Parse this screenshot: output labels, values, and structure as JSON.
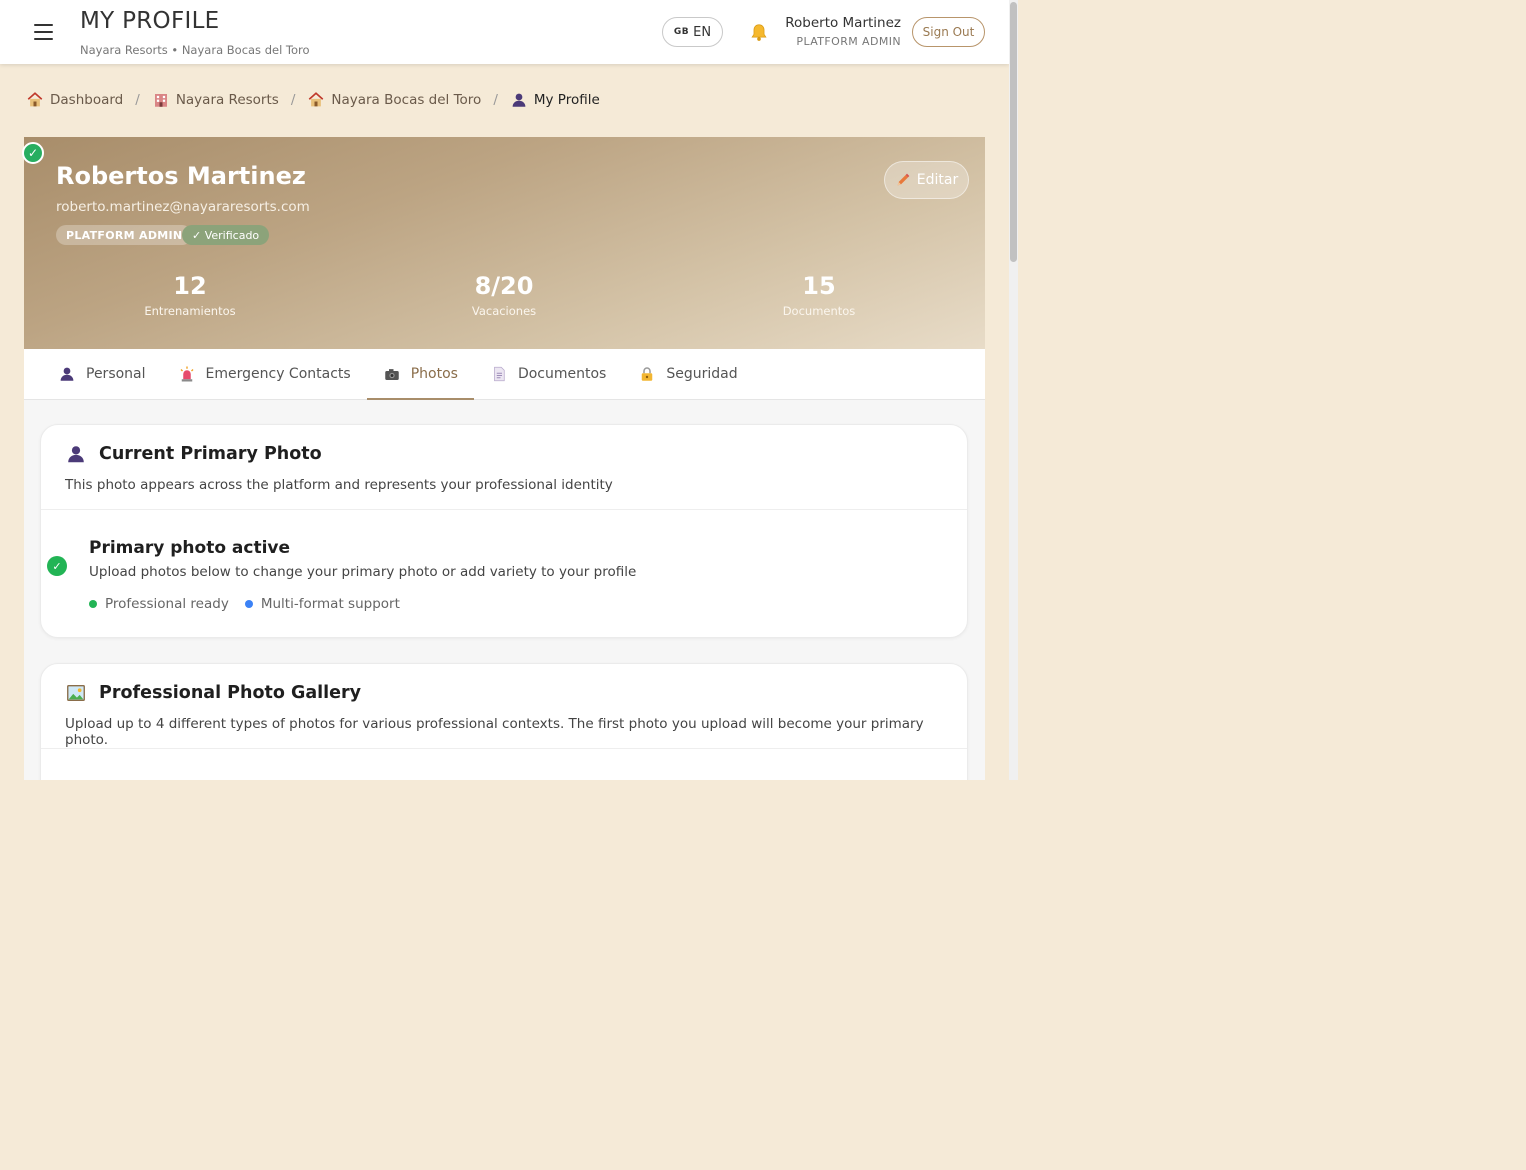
{
  "header": {
    "title": "MY PROFILE",
    "subtitle": "Nayara Resorts • Nayara Bocas del Toro",
    "lang_flag": "GB",
    "lang_code": "EN",
    "user_name": "Roberto Martinez",
    "user_role": "PLATFORM ADMIN",
    "signout_label": "Sign Out"
  },
  "breadcrumb": [
    {
      "label": "Dashboard",
      "icon": "house-icon"
    },
    {
      "label": "Nayara Resorts",
      "icon": "hotel-icon"
    },
    {
      "label": "Nayara Bocas del Toro",
      "icon": "house-icon"
    },
    {
      "label": "My Profile",
      "icon": "person-icon"
    }
  ],
  "profile": {
    "name": "Robertos Martinez",
    "email": "roberto.martinez@nayararesorts.com",
    "role_badge": "PLATFORM ADMIN",
    "verified_badge": "✓ Verificado",
    "edit_label": "Editar",
    "stats": [
      {
        "value": "12",
        "label": "Entrenamientos"
      },
      {
        "value": "8/20",
        "label": "Vacaciones"
      },
      {
        "value": "15",
        "label": "Documentos"
      }
    ]
  },
  "tabs": [
    {
      "label": "Personal",
      "icon": "person-icon"
    },
    {
      "label": "Emergency Contacts",
      "icon": "siren-icon"
    },
    {
      "label": "Photos",
      "icon": "camera-icon",
      "active": true
    },
    {
      "label": "Documentos",
      "icon": "document-icon"
    },
    {
      "label": "Seguridad",
      "icon": "lock-icon"
    }
  ],
  "primary_photo": {
    "title": "Current Primary Photo",
    "description": "This photo appears across the platform and represents your professional identity",
    "status_title": "Primary photo active",
    "status_desc": "Upload photos below to change your primary photo or add variety to your profile",
    "features": [
      {
        "label": "Professional ready",
        "color": "#22b455"
      },
      {
        "label": "Multi-format support",
        "color": "#3b82f6"
      }
    ]
  },
  "gallery": {
    "title": "Professional Photo Gallery",
    "description": "Upload up to 4 different types of photos for various professional contexts. The first photo you upload will become your primary photo."
  },
  "colors": {
    "page_bg": "#f5ead7",
    "accent": "#a88d6a",
    "success": "#22b455"
  }
}
